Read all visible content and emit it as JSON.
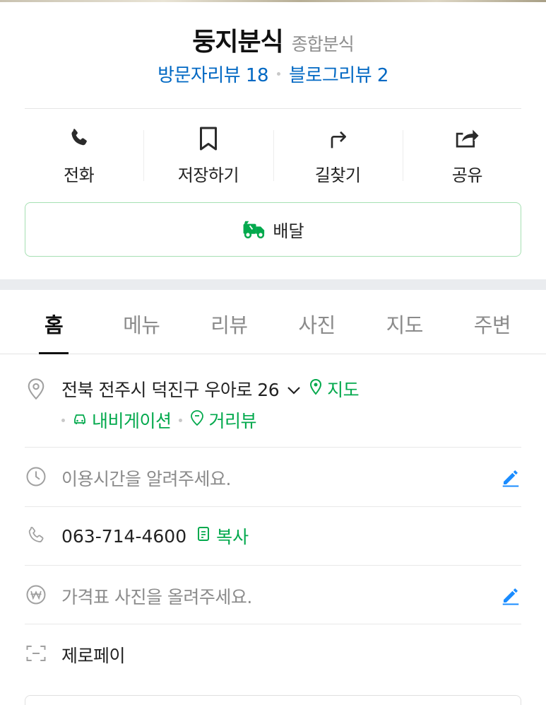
{
  "place": {
    "name": "둥지분식",
    "category": "종합분식",
    "visitor_reviews": "방문자리뷰 18",
    "blog_reviews": "블로그리뷰 2"
  },
  "actions": {
    "call": "전화",
    "save": "저장하기",
    "directions": "길찾기",
    "share": "공유"
  },
  "delivery": {
    "label": "배달"
  },
  "tabs": [
    "홈",
    "메뉴",
    "리뷰",
    "사진",
    "지도",
    "주변"
  ],
  "active_tab": "홈",
  "info": {
    "address": "전북 전주시 덕진구 우아로 26",
    "map_link": "지도",
    "navigation_link": "내비게이션",
    "street_view_link": "거리뷰",
    "hours_placeholder": "이용시간을 알려주세요.",
    "phone": "063-714-4600",
    "copy_label": "복사",
    "price_placeholder": "가격표 사진을 올려주세요.",
    "zeropay": "제로페이"
  },
  "colors": {
    "link_blue": "#0068c3",
    "green": "#03a94d",
    "edit_blue": "#1a8cff",
    "icon_gray": "#a0a0a0"
  },
  "icons": [
    "phone-icon",
    "bookmark-icon",
    "directions-icon",
    "share-icon",
    "delivery-truck-icon",
    "location-pin-icon",
    "chevron-down-icon",
    "map-pin-icon",
    "car-icon",
    "streetview-icon",
    "clock-icon",
    "edit-pencil-icon",
    "phone-outline-icon",
    "copy-icon",
    "won-icon",
    "zeropay-scan-icon"
  ]
}
